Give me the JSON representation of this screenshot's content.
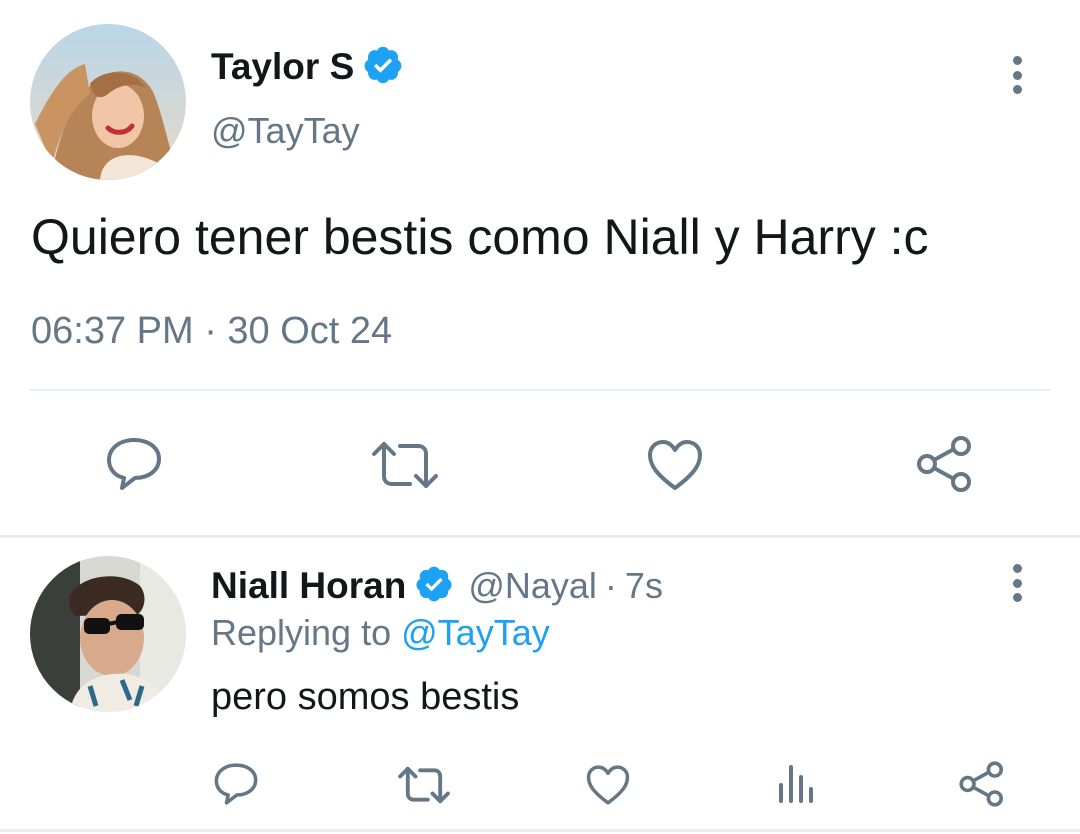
{
  "main_tweet": {
    "author": {
      "name": "Taylor S",
      "handle": "@TayTay",
      "verified": true
    },
    "text": "Quiero tener bestis como Niall y Harry :c",
    "timestamp": "06:37 PM · 30 Oct 24",
    "actions": [
      "reply-icon",
      "retweet-icon",
      "like-icon",
      "share-icon"
    ]
  },
  "reply_tweet": {
    "author": {
      "name": "Niall Horan",
      "handle": "@Nayal",
      "verified": true
    },
    "separator": "·",
    "time_ago": "7s",
    "replying_prefix": "Replying to",
    "replying_to": "@TayTay",
    "text": "pero somos bestis",
    "actions": [
      "reply-icon",
      "retweet-icon",
      "like-icon",
      "analytics-icon",
      "share-icon"
    ]
  },
  "colors": {
    "accent": "#1da1f2",
    "secondary_text": "#657786",
    "icon_gray": "#657786",
    "divider": "#e6ecf0"
  }
}
